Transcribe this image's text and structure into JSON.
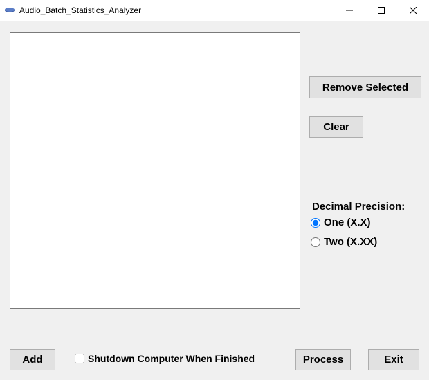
{
  "window": {
    "title": "Audio_Batch_Statistics_Analyzer"
  },
  "buttons": {
    "remove_selected": "Remove Selected",
    "clear": "Clear",
    "add": "Add",
    "process": "Process",
    "exit": "Exit"
  },
  "precision": {
    "label": "Decimal Precision:",
    "options": {
      "one": "One (X.X)",
      "two": "Two (X.XX)"
    },
    "selected": "one"
  },
  "shutdown": {
    "label": "Shutdown Computer When Finished",
    "checked": false
  },
  "listbox": {
    "items": []
  }
}
